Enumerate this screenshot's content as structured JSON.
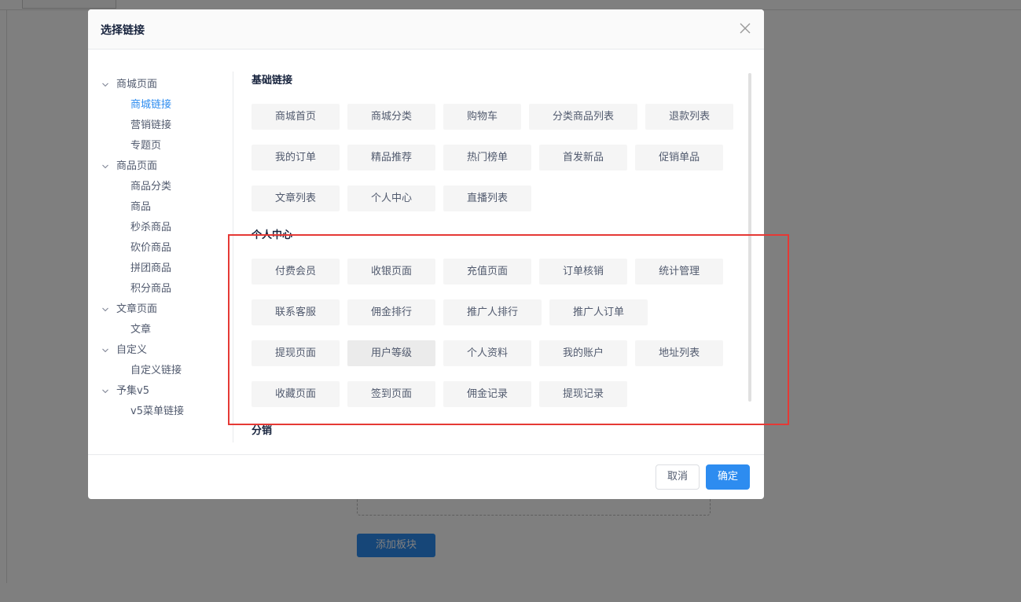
{
  "background": {
    "add_block_label": "添加板块"
  },
  "modal": {
    "title": "选择链接",
    "cancel_label": "取消",
    "ok_label": "确定"
  },
  "tree": [
    {
      "label": "商城页面",
      "children": [
        {
          "label": "商城链接",
          "active": true
        },
        {
          "label": "营销链接"
        },
        {
          "label": "专题页"
        }
      ]
    },
    {
      "label": "商品页面",
      "children": [
        {
          "label": "商品分类"
        },
        {
          "label": "商品"
        },
        {
          "label": "秒杀商品"
        },
        {
          "label": "砍价商品"
        },
        {
          "label": "拼团商品"
        },
        {
          "label": "积分商品"
        }
      ]
    },
    {
      "label": "文章页面",
      "children": [
        {
          "label": "文章"
        }
      ]
    },
    {
      "label": "自定义",
      "children": [
        {
          "label": "自定义链接"
        }
      ]
    },
    {
      "label": "予集v5",
      "children": [
        {
          "label": "v5菜单链接"
        }
      ]
    }
  ],
  "sections": [
    {
      "title": "基础链接",
      "links": [
        "商城首页",
        "商城分类",
        "购物车",
        "分类商品列表",
        "退款列表",
        "我的订单",
        "精品推荐",
        "热门榜单",
        "首发新品",
        "促销单品",
        "文章列表",
        "个人中心",
        "直播列表"
      ]
    },
    {
      "title": "个人中心",
      "links": [
        "付费会员",
        "收银页面",
        "充值页面",
        "订单核销",
        "统计管理",
        "联系客服",
        "佣金排行",
        "推广人排行",
        "推广人订单",
        "提现页面",
        "用户等级",
        "个人资料",
        "我的账户",
        "地址列表",
        "收藏页面",
        "签到页面",
        "佣金记录",
        "提现记录"
      ],
      "hovered": "用户等级"
    },
    {
      "title": "分销",
      "links": []
    }
  ],
  "colors": {
    "primary": "#2d8cf0",
    "highlight": "#e53935"
  }
}
